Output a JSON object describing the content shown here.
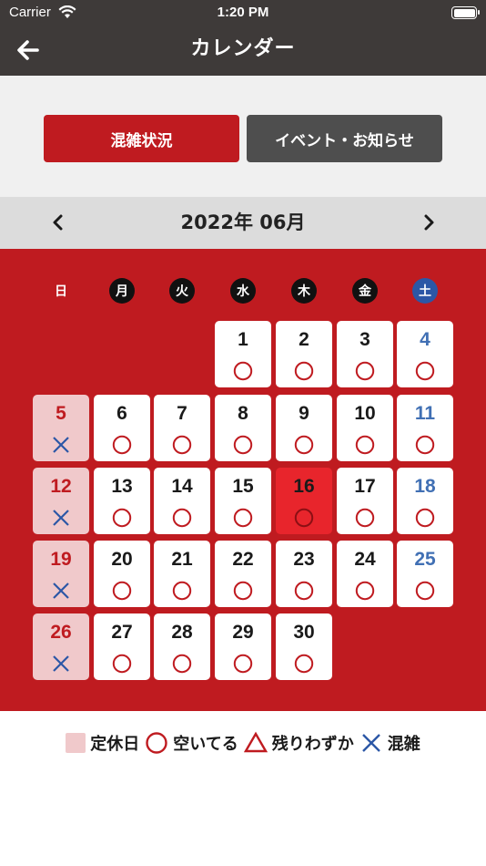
{
  "status_bar": {
    "carrier": "Carrier",
    "time": "1:20 PM"
  },
  "nav": {
    "title": "カレンダー",
    "back_icon": "arrow-left-icon"
  },
  "segments": [
    {
      "label": "混雑状況",
      "selected": true
    },
    {
      "label": "イベント・お知らせ",
      "selected": false
    }
  ],
  "month": {
    "title": "2022年 06月"
  },
  "weekdays": [
    "日",
    "月",
    "火",
    "水",
    "木",
    "金",
    "土"
  ],
  "days": [
    {
      "day": "1",
      "mark": "empty"
    },
    {
      "day": "2",
      "mark": "empty"
    },
    {
      "day": "3",
      "mark": "empty"
    },
    {
      "day": "4",
      "mark": "empty"
    },
    {
      "day": "5",
      "mark": "crowded",
      "closed": true
    },
    {
      "day": "6",
      "mark": "empty"
    },
    {
      "day": "7",
      "mark": "empty"
    },
    {
      "day": "8",
      "mark": "empty"
    },
    {
      "day": "9",
      "mark": "empty"
    },
    {
      "day": "10",
      "mark": "empty"
    },
    {
      "day": "11",
      "mark": "empty"
    },
    {
      "day": "12",
      "mark": "crowded",
      "closed": true
    },
    {
      "day": "13",
      "mark": "empty"
    },
    {
      "day": "14",
      "mark": "empty"
    },
    {
      "day": "15",
      "mark": "empty"
    },
    {
      "day": "16",
      "mark": "empty",
      "today": true
    },
    {
      "day": "17",
      "mark": "empty"
    },
    {
      "day": "18",
      "mark": "empty"
    },
    {
      "day": "19",
      "mark": "crowded",
      "closed": true
    },
    {
      "day": "20",
      "mark": "empty"
    },
    {
      "day": "21",
      "mark": "empty"
    },
    {
      "day": "22",
      "mark": "empty"
    },
    {
      "day": "23",
      "mark": "empty"
    },
    {
      "day": "24",
      "mark": "empty"
    },
    {
      "day": "25",
      "mark": "empty"
    },
    {
      "day": "26",
      "mark": "crowded",
      "closed": true
    },
    {
      "day": "27",
      "mark": "empty"
    },
    {
      "day": "28",
      "mark": "empty"
    },
    {
      "day": "29",
      "mark": "empty"
    },
    {
      "day": "30",
      "mark": "empty"
    }
  ],
  "first_weekday": 3,
  "legend": {
    "closed": "定休日",
    "empty": "空いてる",
    "few": "残りわずか",
    "crowded": "混雑"
  },
  "colors": {
    "brand_red": "#bf1b20",
    "today_red": "#e8252c",
    "closed_pink": "#f0c9cb",
    "saturday_blue": "#4170b4",
    "crowded_blue": "#2c57a6",
    "dark_header": "#3e3a39"
  }
}
